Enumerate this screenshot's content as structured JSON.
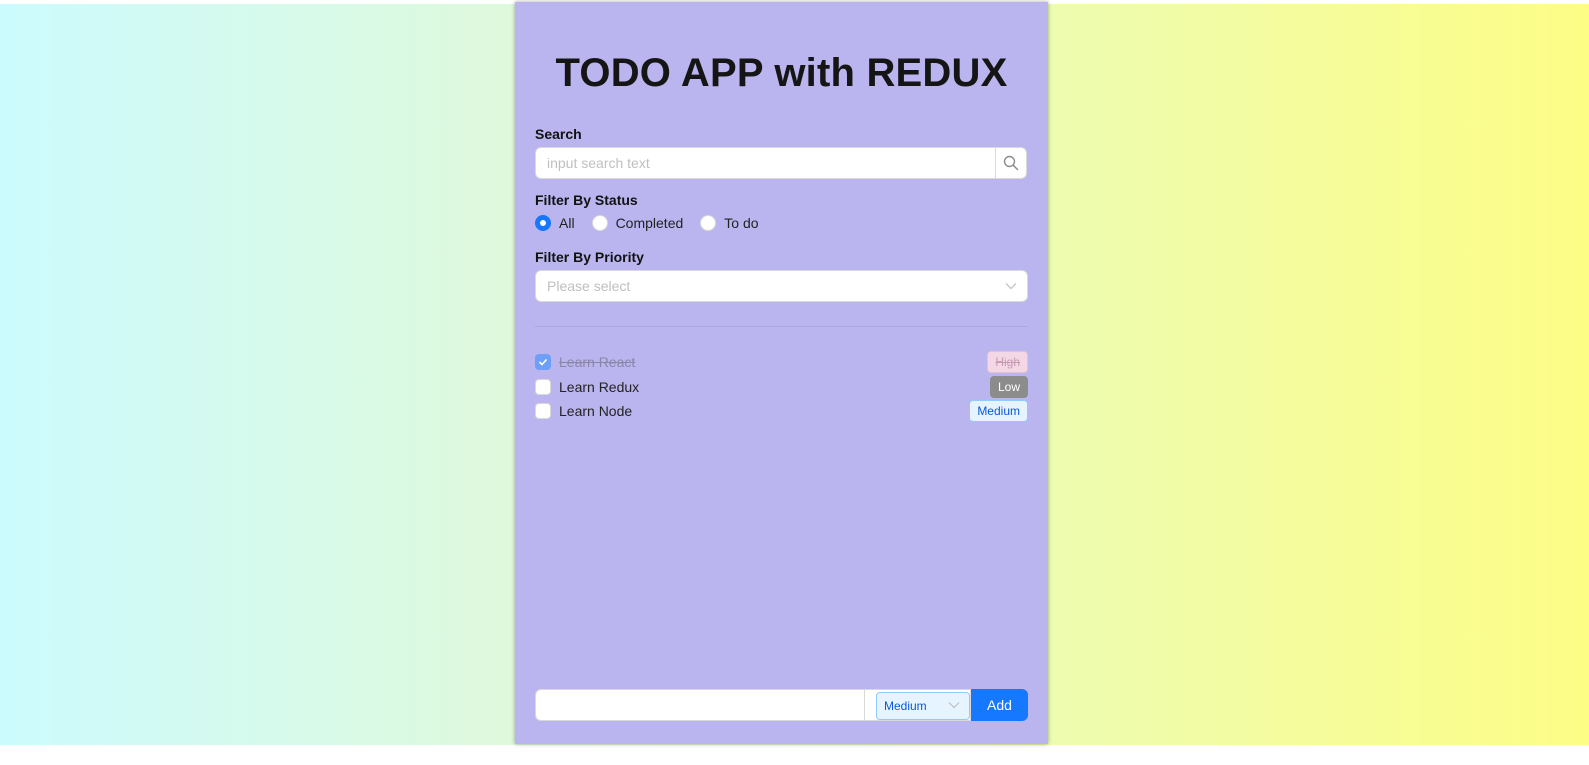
{
  "app": {
    "title": "TODO APP with REDUX"
  },
  "search": {
    "label": "Search",
    "placeholder": "input search text",
    "value": "",
    "button_icon": "search-icon"
  },
  "status_filter": {
    "label": "Filter By Status",
    "options": [
      {
        "label": "All",
        "checked": true
      },
      {
        "label": "Completed",
        "checked": false
      },
      {
        "label": "To do",
        "checked": false
      }
    ]
  },
  "priority_filter": {
    "label": "Filter By Priority",
    "placeholder": "Please select",
    "icon": "chevron-down-icon"
  },
  "todos": [
    {
      "name": "Learn React",
      "completed": true,
      "priority": "High"
    },
    {
      "name": "Learn Redux",
      "completed": false,
      "priority": "Low"
    },
    {
      "name": "Learn Node",
      "completed": false,
      "priority": "Medium"
    }
  ],
  "add_form": {
    "value": "",
    "priority": "Medium",
    "button_label": "Add"
  },
  "colors": {
    "card_background": "#bab5ef",
    "accent": "#1677ff",
    "high_tag": "#f3d7e5",
    "low_tag": "#8c8c8c",
    "medium_tag": "#e6f4ff"
  }
}
